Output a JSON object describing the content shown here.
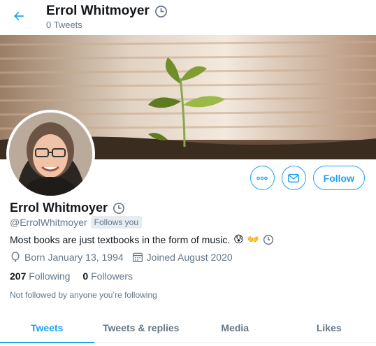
{
  "header": {
    "name": "Errol Whitmoyer",
    "tweet_count": "0 Tweets"
  },
  "profile": {
    "name": "Errol Whitmoyer",
    "handle": "@ErrolWhitmoyer",
    "follows_you": "Follows you",
    "bio": "Most books are just textbooks in the form of music.",
    "bio_emojis": [
      "😰",
      "👐"
    ],
    "born": "Born January 13, 1994",
    "joined": "Joined August 2020",
    "following_count": "207",
    "following_label": "Following",
    "followers_count": "0",
    "followers_label": "Followers",
    "not_followed": "Not followed by anyone you’re following"
  },
  "actions": {
    "follow_label": "Follow",
    "more_icon": "more-icon",
    "message_icon": "envelope-icon"
  },
  "tabs": [
    {
      "label": "Tweets",
      "active": true
    },
    {
      "label": "Tweets & replies",
      "active": false
    },
    {
      "label": "Media",
      "active": false
    },
    {
      "label": "Likes",
      "active": false
    }
  ],
  "colors": {
    "accent": "#1da1f2",
    "secondary_text": "#657786",
    "primary_text": "#14171a"
  }
}
